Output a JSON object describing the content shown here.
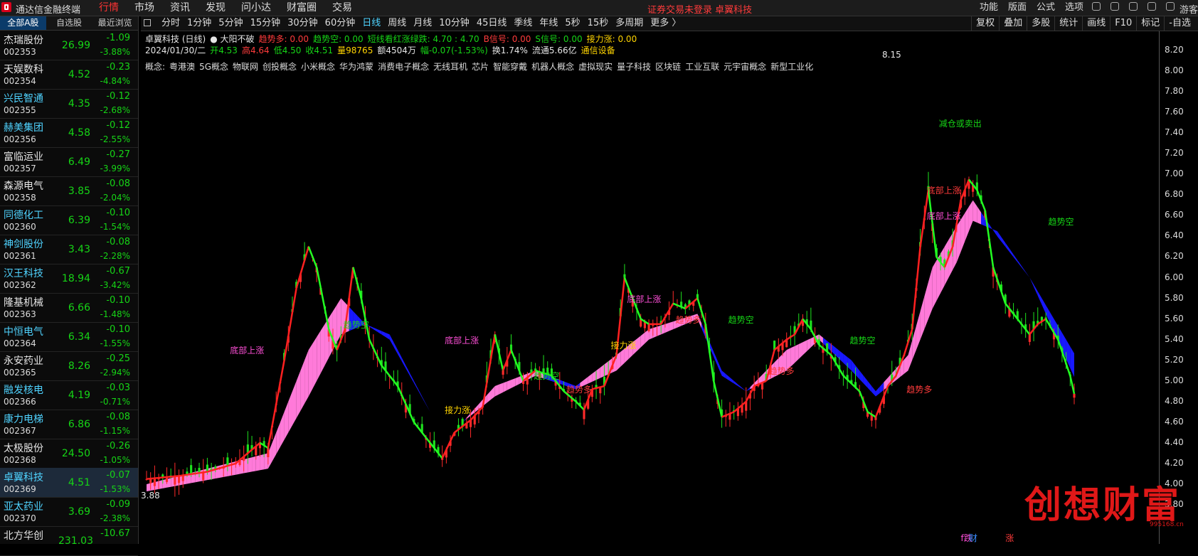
{
  "topbar": {
    "app_title": "通达信金融终端",
    "menu": [
      "行情",
      "市场",
      "资讯",
      "发现",
      "问小达",
      "财富圈",
      "交易"
    ],
    "notice": "证券交易未登录 卓翼科技",
    "right_menu": [
      "功能",
      "版面",
      "公式",
      "选项"
    ],
    "guest": "游客"
  },
  "sidebar": {
    "tabs": [
      "全部A股",
      "自选股",
      "最近浏览"
    ],
    "stocks": [
      {
        "name": "杰瑞股份",
        "code": "002353",
        "price": "26.99",
        "change": "-1.09",
        "pct": "-3.88%"
      },
      {
        "name": "天娱数科",
        "code": "002354",
        "price": "4.52",
        "change": "-0.23",
        "pct": "-4.84%"
      },
      {
        "name": "兴民智通",
        "code": "002355",
        "price": "4.35",
        "change": "-0.12",
        "pct": "-2.68%"
      },
      {
        "name": "赫美集团",
        "code": "002356",
        "price": "4.58",
        "change": "-0.12",
        "pct": "-2.55%"
      },
      {
        "name": "富临运业",
        "code": "002357",
        "price": "6.49",
        "change": "-0.27",
        "pct": "-3.99%"
      },
      {
        "name": "森源电气",
        "code": "002358",
        "price": "3.85",
        "change": "-0.08",
        "pct": "-2.04%"
      },
      {
        "name": "同德化工",
        "code": "002360",
        "price": "6.39",
        "change": "-0.10",
        "pct": "-1.54%"
      },
      {
        "name": "神剑股份",
        "code": "002361",
        "price": "3.43",
        "change": "-0.08",
        "pct": "-2.28%"
      },
      {
        "name": "汉王科技",
        "code": "002362",
        "price": "18.94",
        "change": "-0.67",
        "pct": "-3.42%"
      },
      {
        "name": "隆基机械",
        "code": "002363",
        "price": "6.66",
        "change": "-0.10",
        "pct": "-1.48%"
      },
      {
        "name": "中恒电气",
        "code": "002364",
        "price": "6.34",
        "change": "-0.10",
        "pct": "-1.55%"
      },
      {
        "name": "永安药业",
        "code": "002365",
        "price": "8.26",
        "change": "-0.25",
        "pct": "-2.94%"
      },
      {
        "name": "融发核电",
        "code": "002366",
        "price": "4.19",
        "change": "-0.03",
        "pct": "-0.71%"
      },
      {
        "name": "康力电梯",
        "code": "002367",
        "price": "6.86",
        "change": "-0.08",
        "pct": "-1.15%"
      },
      {
        "name": "太极股份",
        "code": "002368",
        "price": "24.50",
        "change": "-0.26",
        "pct": "-1.05%"
      },
      {
        "name": "卓翼科技",
        "code": "002369",
        "price": "4.51",
        "change": "-0.07",
        "pct": "-1.53%"
      },
      {
        "name": "亚太药业",
        "code": "002370",
        "price": "3.69",
        "change": "-0.09",
        "pct": "-2.38%"
      },
      {
        "name": "北方华创",
        "code": "",
        "price": "231.03",
        "change": "-10.67",
        "pct": ""
      }
    ]
  },
  "period_tabs": [
    "分时",
    "1分钟",
    "5分钟",
    "15分钟",
    "30分钟",
    "60分钟",
    "日线",
    "周线",
    "月线",
    "10分钟",
    "45日线",
    "季线",
    "年线",
    "5秒",
    "15秒",
    "多周期",
    "更多 〉"
  ],
  "tool_buttons": [
    "复权",
    "叠加",
    "多股",
    "统计",
    "画线",
    "F10",
    "标记",
    "-自选"
  ],
  "info": {
    "line1": [
      {
        "t": "卓翼科技 (日线)",
        "c": "#e6e6e6"
      },
      {
        "t": "● 大阳不破",
        "c": "#e6e6e6"
      },
      {
        "t": "趋势多: 0.00",
        "c": "#ff3b3b"
      },
      {
        "t": "趋势空: 0.00",
        "c": "#16d516"
      },
      {
        "t": "短线看红涨绿跌: 4.70 : 4.70",
        "c": "#16d516"
      },
      {
        "t": "B信号: 0.00",
        "c": "#ff3b3b"
      },
      {
        "t": "S信号: 0.00",
        "c": "#16d516"
      },
      {
        "t": "接力涨: 0.00",
        "c": "#ffd400"
      }
    ],
    "line2": [
      {
        "t": "2024/01/30/二",
        "c": "#e6e6e6"
      },
      {
        "t": "开4.53",
        "c": "#16d516"
      },
      {
        "t": "高4.64",
        "c": "#ff3b3b"
      },
      {
        "t": "低4.50",
        "c": "#16d516"
      },
      {
        "t": "收4.51",
        "c": "#16d516"
      },
      {
        "t": "量98765",
        "c": "#ffd400"
      },
      {
        "t": "额4504万",
        "c": "#e6e6e6"
      },
      {
        "t": "幅-0.07(-1.53%)",
        "c": "#16d516"
      },
      {
        "t": "换1.74%",
        "c": "#e6e6e6"
      },
      {
        "t": "流通5.66亿",
        "c": "#e6e6e6"
      },
      {
        "t": "通信设备",
        "c": "#ffd400"
      }
    ],
    "concepts": [
      "概念:",
      "粤港澳",
      "5G概念",
      "物联网",
      "创投概念",
      "小米概念",
      "华为鸿蒙",
      "消费电子概念",
      "无线耳机",
      "芯片",
      "智能穿戴",
      "机器人概念",
      "虚拟现实",
      "量子科技",
      "区块链",
      "工业互联",
      "元宇宙概念",
      "新型工业化"
    ]
  },
  "chart_data": {
    "type": "candlestick",
    "ylim": [
      3.8,
      8.2
    ],
    "y_ticks": [
      "8.20",
      "8.00",
      "7.80",
      "7.60",
      "7.40",
      "7.20",
      "7.00",
      "6.80",
      "6.60",
      "6.40",
      "6.20",
      "6.00",
      "5.80",
      "5.60",
      "5.40",
      "5.20",
      "5.00",
      "4.80",
      "4.60",
      "4.40",
      "4.20",
      "4.00",
      "3.80"
    ],
    "max_label": "8.15",
    "min_label": "3.88",
    "close_path": [
      [
        0,
        4.05
      ],
      [
        8,
        4.08
      ],
      [
        15,
        4.12
      ],
      [
        22,
        4.2
      ],
      [
        28,
        4.4
      ],
      [
        30,
        4.35
      ],
      [
        34,
        5.2
      ],
      [
        37,
        5.9
      ],
      [
        40,
        6.3
      ],
      [
        42,
        6.1
      ],
      [
        45,
        5.5
      ],
      [
        47,
        5.3
      ],
      [
        49,
        5.5
      ],
      [
        51,
        6.1
      ],
      [
        53,
        5.8
      ],
      [
        55,
        5.4
      ],
      [
        58,
        5.15
      ],
      [
        62,
        4.95
      ],
      [
        66,
        4.6
      ],
      [
        70,
        4.4
      ],
      [
        73,
        4.25
      ],
      [
        76,
        4.5
      ],
      [
        80,
        4.62
      ],
      [
        83,
        4.75
      ],
      [
        86,
        5.45
      ],
      [
        88,
        5.1
      ],
      [
        90,
        5.3
      ],
      [
        93,
        5.0
      ],
      [
        96,
        5.1
      ],
      [
        100,
        5.05
      ],
      [
        103,
        4.9
      ],
      [
        106,
        4.8
      ],
      [
        108,
        4.72
      ],
      [
        110,
        4.92
      ],
      [
        113,
        4.95
      ],
      [
        116,
        5.25
      ],
      [
        118,
        6.0
      ],
      [
        120,
        5.8
      ],
      [
        122,
        5.6
      ],
      [
        124,
        5.55
      ],
      [
        127,
        5.55
      ],
      [
        130,
        5.75
      ],
      [
        133,
        5.7
      ],
      [
        136,
        5.8
      ],
      [
        138,
        5.55
      ],
      [
        140,
        5.0
      ],
      [
        142,
        4.65
      ],
      [
        145,
        4.7
      ],
      [
        148,
        4.8
      ],
      [
        150,
        4.95
      ],
      [
        153,
        5.0
      ],
      [
        155,
        5.3
      ],
      [
        158,
        5.4
      ],
      [
        160,
        5.45
      ],
      [
        162,
        5.6
      ],
      [
        164,
        5.5
      ],
      [
        166,
        5.35
      ],
      [
        169,
        5.25
      ],
      [
        172,
        5.05
      ],
      [
        176,
        4.9
      ],
      [
        178,
        4.7
      ],
      [
        180,
        4.65
      ],
      [
        183,
        4.95
      ],
      [
        185,
        5.05
      ],
      [
        187,
        5.25
      ],
      [
        189,
        5.5
      ],
      [
        191,
        6.3
      ],
      [
        193,
        6.85
      ],
      [
        195,
        6.2
      ],
      [
        197,
        6.1
      ],
      [
        199,
        6.3
      ],
      [
        201,
        6.75
      ],
      [
        203,
        6.95
      ],
      [
        205,
        6.85
      ],
      [
        207,
        6.65
      ],
      [
        209,
        6.1
      ],
      [
        212,
        5.75
      ],
      [
        215,
        5.6
      ],
      [
        218,
        5.45
      ],
      [
        220,
        5.55
      ],
      [
        222,
        5.6
      ],
      [
        225,
        5.4
      ],
      [
        228,
        5.05
      ],
      [
        230,
        4.7
      ]
    ],
    "band_up_path": [
      [
        0,
        4.0
      ],
      [
        30,
        4.3
      ],
      [
        40,
        5.3
      ],
      [
        48,
        5.8
      ],
      [
        54,
        5.55
      ],
      [
        60,
        5.45
      ],
      [
        70,
        4.7
      ],
      [
        78,
        4.6
      ],
      [
        86,
        4.95
      ],
      [
        96,
        5.1
      ],
      [
        106,
        4.95
      ],
      [
        116,
        5.25
      ],
      [
        124,
        5.5
      ],
      [
        136,
        5.65
      ],
      [
        142,
        5.1
      ],
      [
        148,
        4.9
      ],
      [
        158,
        5.3
      ],
      [
        166,
        5.45
      ],
      [
        174,
        5.2
      ],
      [
        180,
        4.9
      ],
      [
        188,
        5.25
      ],
      [
        194,
        6.1
      ],
      [
        200,
        6.5
      ],
      [
        204,
        6.75
      ],
      [
        210,
        6.4
      ],
      [
        218,
        6.0
      ],
      [
        230,
        5.2
      ]
    ],
    "band_dn_path": [
      [
        0,
        3.93
      ],
      [
        30,
        4.15
      ],
      [
        40,
        4.85
      ],
      [
        48,
        5.45
      ],
      [
        54,
        5.55
      ],
      [
        60,
        5.4
      ],
      [
        70,
        4.7
      ],
      [
        78,
        4.6
      ],
      [
        86,
        4.85
      ],
      [
        96,
        5.05
      ],
      [
        106,
        4.92
      ],
      [
        116,
        5.1
      ],
      [
        124,
        5.4
      ],
      [
        136,
        5.6
      ],
      [
        142,
        5.05
      ],
      [
        148,
        4.9
      ],
      [
        158,
        5.1
      ],
      [
        166,
        5.4
      ],
      [
        174,
        5.1
      ],
      [
        180,
        4.85
      ],
      [
        188,
        5.1
      ],
      [
        194,
        5.7
      ],
      [
        200,
        6.15
      ],
      [
        204,
        6.55
      ],
      [
        210,
        6.45
      ],
      [
        218,
        6.0
      ],
      [
        230,
        4.95
      ]
    ],
    "candle_count": 230,
    "annotations": [
      {
        "text": "8.15",
        "i": 183,
        "y": 8.15,
        "c": "#e6e6e6"
      },
      {
        "text": "3.88",
        "i": 0,
        "y": 3.88,
        "c": "#e6e6e6"
      },
      {
        "text": "趋势空",
        "i": 50,
        "y": 5.55,
        "c": "#16d516"
      },
      {
        "text": "底部上涨",
        "i": 22,
        "y": 5.3,
        "c": "#ff4fd8"
      },
      {
        "text": "底部上涨",
        "i": 75,
        "y": 5.4,
        "c": "#ff4fd8"
      },
      {
        "text": "接力涨",
        "i": 75,
        "y": 4.72,
        "c": "#ffd400"
      },
      {
        "text": "趋势空",
        "i": 97,
        "y": 5.05,
        "c": "#16d516"
      },
      {
        "text": "趋势多",
        "i": 105,
        "y": 4.92,
        "c": "#ff3b3b"
      },
      {
        "text": "接力涨",
        "i": 116,
        "y": 5.35,
        "c": "#ffd400"
      },
      {
        "text": "底部上涨",
        "i": 120,
        "y": 5.8,
        "c": "#ff4fd8"
      },
      {
        "text": "趋势多",
        "i": 132,
        "y": 5.6,
        "c": "#ff3b3b"
      },
      {
        "text": "趋势空",
        "i": 145,
        "y": 5.6,
        "c": "#16d516"
      },
      {
        "text": "趋势多",
        "i": 155,
        "y": 5.1,
        "c": "#ff3b3b"
      },
      {
        "text": "趋势空",
        "i": 175,
        "y": 5.4,
        "c": "#16d516"
      },
      {
        "text": "趋势多",
        "i": 189,
        "y": 4.92,
        "c": "#ff3b3b"
      },
      {
        "text": "减仓或卖出",
        "i": 197,
        "y": 7.5,
        "c": "#16d516"
      },
      {
        "text": "底部上涨",
        "i": 194,
        "y": 6.6,
        "c": "#ff4fd8"
      },
      {
        "text": "底部上涨",
        "i": 194,
        "y": 6.85,
        "c": "#ff3b3b"
      },
      {
        "text": "趋势空",
        "i": 224,
        "y": 6.55,
        "c": "#16d516"
      }
    ],
    "bottom_markers": [
      {
        "text": "f跌",
        "i": 201,
        "c": "#ff4fd8"
      },
      {
        "text": "财",
        "i": 203,
        "c": "#3a8dff"
      },
      {
        "text": "涨",
        "i": 212,
        "c": "#ff3b3b"
      }
    ]
  },
  "watermark": {
    "title": "创想财富",
    "sub": "995168.cn"
  }
}
